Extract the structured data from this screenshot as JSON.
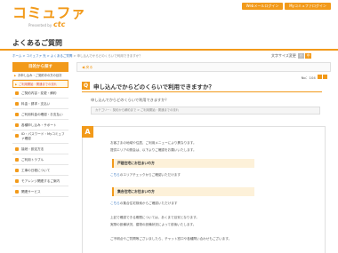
{
  "header": {
    "logo_main": "コミュファ",
    "logo_sub": "Presented by",
    "logo_brand": "ctc",
    "btn_web_login": "Webメールログイン",
    "btn_mypage": "Myコミュファログイン"
  },
  "page_title": "よくあるご質問",
  "breadcrumb": {
    "home": "ホーム > コミュファ 光 > よくあるご質問",
    "current": " > 申し込んでからどのくらいで利用できますか？"
  },
  "font_size": {
    "label": "文字サイズ変更",
    "opt1": "小",
    "opt2": "中"
  },
  "sidebar": {
    "head": "目的から探す",
    "links": [
      "お申し込み・ご契約中の方の目次",
      "ご利用開始・開通までの流れ"
    ],
    "items": [
      "ご契約内容・変更・解約",
      "料金・請求・支払い",
      "ご利用料金の確認・お支払い",
      "各種申し込み・サポート",
      "ID・パスワード・Myコミュファ確認",
      "接続・設定方法",
      "ご利用トラブル",
      "工事の日程について",
      "モアレンジ関連するご案内",
      "関連サービス"
    ]
  },
  "main": {
    "back": "◀ 戻る",
    "meta_no": "No：104",
    "q_badge": "Q",
    "q_title": "申し込んでからどのくらいで利用できますか？",
    "q_text": "申し込んでからどのくらいで利用できますか？",
    "q_cat": "カテゴリー：契約から解約まで > ご利用開始・開通までの流れ",
    "a_badge": "A",
    "a_lines": [
      "お客さまの地域や住居、ご利用メニューにより異なります。",
      "提供エリアの照会は、以下よりご確認をお願いいたします。"
    ],
    "a_sub1": "戸建住宅にお住まいの方",
    "a_link1_label": "こちら",
    "a_link1_rest": "のエリアチェックからご確認いただけます",
    "a_sub2": "集合住宅にお住まいの方",
    "a_link2_label": "こちら",
    "a_link2_rest": "の集合住宅検索からご確認いただけます",
    "a_lines2": [
      "上記で確認できる期間については、あくまで目安となります。",
      "実際の設備状況、建物の設備状況によって前後いたします。",
      "ご不明点やご質問等ございましたら、チャット窓口や各種問い合わせもございます。"
    ]
  },
  "colors": {
    "accent": "#f29a1a",
    "link": "#2a6ebd"
  }
}
